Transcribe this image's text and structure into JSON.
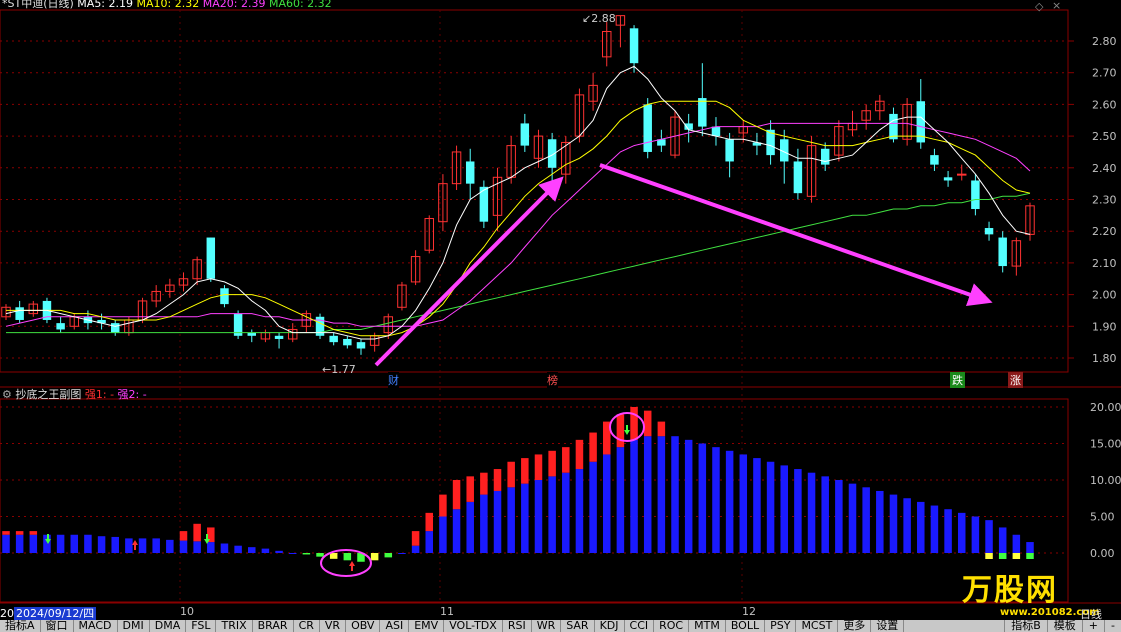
{
  "stock": {
    "name": "*ST中迪(日线)",
    "ma_labels": [
      {
        "text": "MA5: 2.19",
        "color": "#ffffff"
      },
      {
        "text": "MA10: 2.32",
        "color": "#ffff00"
      },
      {
        "text": "MA20: 2.39",
        "color": "#ff40ff"
      },
      {
        "text": "MA60: 2.32",
        "color": "#40e040"
      }
    ]
  },
  "indicator": {
    "name": "抄底之王副图",
    "strong1": "强1: -",
    "strong2": "强2: -"
  },
  "annotations": {
    "high_label": "2.88",
    "low_label": "1.77"
  },
  "event_tags": [
    {
      "text": "财",
      "color": "#4080ff",
      "bg": "#000"
    },
    {
      "text": "榜",
      "color": "#ff5050",
      "bg": "#000"
    },
    {
      "text": "跌",
      "color": "#ffffff",
      "bg": "#1a8a1a"
    },
    {
      "text": "涨",
      "color": "#ffffff",
      "bg": "#8a1a1a"
    }
  ],
  "price_ticks": [
    "2.80",
    "2.70",
    "2.60",
    "2.50",
    "2.40",
    "2.30",
    "2.20",
    "2.10",
    "2.00",
    "1.90",
    "1.80"
  ],
  "ind_ticks": [
    "20.00",
    "15.00",
    "10.00",
    "5.00",
    "0.00"
  ],
  "x_labels": [
    "10",
    "11",
    "12"
  ],
  "date_badge": {
    "prefix": "20",
    "date": "2024/09/12/四"
  },
  "period_label": "日线",
  "watermark": {
    "logo": "万股网",
    "url": "www.201082.com"
  },
  "tabs": [
    "指标A",
    "窗口",
    "MACD",
    "DMI",
    "DMA",
    "FSL",
    "TRIX",
    "BRAR",
    "CR",
    "VR",
    "OBV",
    "ASI",
    "EMV",
    "VOL-TDX",
    "RSI",
    "WR",
    "SAR",
    "KDJ",
    "CCI",
    "ROC",
    "MTM",
    "BOLL",
    "PSY",
    "MCST",
    "更多",
    "设置"
  ],
  "right_tabs": [
    "指标B",
    "模板",
    "+",
    "-"
  ],
  "chart_data": {
    "type": "candlestick",
    "price_range": [
      1.75,
      2.92
    ],
    "ind_range": [
      -2,
      21
    ],
    "candles": [
      [
        1.93,
        1.96,
        1.92,
        1.97
      ],
      [
        1.96,
        1.92,
        1.91,
        1.98
      ],
      [
        1.94,
        1.97,
        1.93,
        1.98
      ],
      [
        1.98,
        1.92,
        1.91,
        1.99
      ],
      [
        1.91,
        1.89,
        1.88,
        1.93
      ],
      [
        1.9,
        1.93,
        1.89,
        1.94
      ],
      [
        1.93,
        1.91,
        1.89,
        1.95
      ],
      [
        1.92,
        1.91,
        1.89,
        1.94
      ],
      [
        1.91,
        1.88,
        1.87,
        1.92
      ],
      [
        1.88,
        1.92,
        1.87,
        1.93
      ],
      [
        1.92,
        1.98,
        1.91,
        1.99
      ],
      [
        1.98,
        2.01,
        1.96,
        2.03
      ],
      [
        2.01,
        2.03,
        1.99,
        2.05
      ],
      [
        2.03,
        2.05,
        2.01,
        2.07
      ],
      [
        2.05,
        2.11,
        2.03,
        2.12
      ],
      [
        2.18,
        2.05,
        2.04,
        2.18
      ],
      [
        2.02,
        1.97,
        1.96,
        2.03
      ],
      [
        1.94,
        1.87,
        1.86,
        1.95
      ],
      [
        1.88,
        1.87,
        1.85,
        1.89
      ],
      [
        1.86,
        1.88,
        1.85,
        1.89
      ],
      [
        1.87,
        1.86,
        1.83,
        1.88
      ],
      [
        1.86,
        1.89,
        1.85,
        1.91
      ],
      [
        1.9,
        1.94,
        1.88,
        1.95
      ],
      [
        1.93,
        1.87,
        1.86,
        1.94
      ],
      [
        1.87,
        1.85,
        1.84,
        1.88
      ],
      [
        1.86,
        1.84,
        1.83,
        1.87
      ],
      [
        1.85,
        1.83,
        1.81,
        1.86
      ],
      [
        1.84,
        1.87,
        1.82,
        1.88
      ],
      [
        1.88,
        1.93,
        1.86,
        1.94
      ],
      [
        1.96,
        2.03,
        1.95,
        2.04
      ],
      [
        2.04,
        2.12,
        2.03,
        2.14
      ],
      [
        2.14,
        2.24,
        2.13,
        2.25
      ],
      [
        2.23,
        2.35,
        2.2,
        2.38
      ],
      [
        2.35,
        2.45,
        2.33,
        2.47
      ],
      [
        2.42,
        2.35,
        2.3,
        2.46
      ],
      [
        2.34,
        2.23,
        2.21,
        2.36
      ],
      [
        2.25,
        2.37,
        2.2,
        2.4
      ],
      [
        2.37,
        2.47,
        2.35,
        2.5
      ],
      [
        2.54,
        2.47,
        2.45,
        2.57
      ],
      [
        2.43,
        2.5,
        2.4,
        2.52
      ],
      [
        2.49,
        2.4,
        2.34,
        2.51
      ],
      [
        2.38,
        2.48,
        2.35,
        2.5
      ],
      [
        2.5,
        2.63,
        2.48,
        2.65
      ],
      [
        2.61,
        2.66,
        2.58,
        2.7
      ],
      [
        2.75,
        2.83,
        2.72,
        2.86
      ],
      [
        2.85,
        2.88,
        2.78,
        2.88
      ],
      [
        2.84,
        2.73,
        2.7,
        2.85
      ],
      [
        2.6,
        2.45,
        2.43,
        2.62
      ],
      [
        2.49,
        2.47,
        2.45,
        2.52
      ],
      [
        2.44,
        2.56,
        2.43,
        2.58
      ],
      [
        2.54,
        2.52,
        2.48,
        2.57
      ],
      [
        2.62,
        2.53,
        2.5,
        2.73
      ],
      [
        2.53,
        2.5,
        2.47,
        2.56
      ],
      [
        2.49,
        2.42,
        2.37,
        2.51
      ],
      [
        2.51,
        2.53,
        2.48,
        2.55
      ],
      [
        2.48,
        2.47,
        2.44,
        2.51
      ],
      [
        2.52,
        2.44,
        2.41,
        2.55
      ],
      [
        2.49,
        2.42,
        2.35,
        2.52
      ],
      [
        2.42,
        2.32,
        2.3,
        2.46
      ],
      [
        2.31,
        2.47,
        2.29,
        2.5
      ],
      [
        2.46,
        2.41,
        2.39,
        2.48
      ],
      [
        2.44,
        2.53,
        2.42,
        2.55
      ],
      [
        2.52,
        2.54,
        2.5,
        2.58
      ],
      [
        2.55,
        2.58,
        2.52,
        2.6
      ],
      [
        2.58,
        2.61,
        2.55,
        2.63
      ],
      [
        2.57,
        2.49,
        2.48,
        2.59
      ],
      [
        2.49,
        2.6,
        2.47,
        2.62
      ],
      [
        2.61,
        2.48,
        2.46,
        2.68
      ],
      [
        2.44,
        2.41,
        2.39,
        2.46
      ],
      [
        2.37,
        2.36,
        2.34,
        2.39
      ],
      [
        2.38,
        2.38,
        2.36,
        2.41
      ],
      [
        2.36,
        2.27,
        2.25,
        2.38
      ],
      [
        2.21,
        2.19,
        2.17,
        2.23
      ],
      [
        2.18,
        2.09,
        2.07,
        2.2
      ],
      [
        2.09,
        2.17,
        2.06,
        2.18
      ],
      [
        2.19,
        2.28,
        2.17,
        2.29
      ]
    ],
    "ma5": [
      1.94,
      1.95,
      1.95,
      1.95,
      1.94,
      1.93,
      1.92,
      1.91,
      1.9,
      1.91,
      1.92,
      1.94,
      1.97,
      2.0,
      2.04,
      2.05,
      2.04,
      2.02,
      1.98,
      1.95,
      1.9,
      1.88,
      1.88,
      1.88,
      1.88,
      1.87,
      1.86,
      1.86,
      1.87,
      1.9,
      1.95,
      2.02,
      2.1,
      2.22,
      2.3,
      2.33,
      2.35,
      2.37,
      2.4,
      2.42,
      2.44,
      2.47,
      2.5,
      2.55,
      2.65,
      2.7,
      2.72,
      2.68,
      2.62,
      2.58,
      2.52,
      2.51,
      2.5,
      2.49,
      2.49,
      2.48,
      2.47,
      2.45,
      2.43,
      2.43,
      2.42,
      2.43,
      2.44,
      2.48,
      2.52,
      2.55,
      2.56,
      2.56,
      2.52,
      2.48,
      2.43,
      2.38,
      2.32,
      2.25,
      2.2,
      2.19
    ],
    "ma10": [
      1.95,
      1.95,
      1.95,
      1.95,
      1.95,
      1.94,
      1.94,
      1.93,
      1.92,
      1.92,
      1.92,
      1.92,
      1.93,
      1.95,
      1.97,
      1.99,
      2.0,
      2.0,
      2.0,
      1.99,
      1.97,
      1.95,
      1.93,
      1.91,
      1.89,
      1.88,
      1.87,
      1.87,
      1.87,
      1.88,
      1.9,
      1.93,
      1.97,
      2.03,
      2.1,
      2.15,
      2.21,
      2.26,
      2.31,
      2.35,
      2.38,
      2.41,
      2.43,
      2.46,
      2.5,
      2.55,
      2.58,
      2.6,
      2.61,
      2.61,
      2.61,
      2.61,
      2.61,
      2.59,
      2.55,
      2.53,
      2.51,
      2.5,
      2.49,
      2.48,
      2.47,
      2.47,
      2.47,
      2.48,
      2.49,
      2.5,
      2.5,
      2.5,
      2.49,
      2.48,
      2.46,
      2.44,
      2.4,
      2.36,
      2.33,
      2.32
    ],
    "ma20": [
      1.9,
      1.91,
      1.92,
      1.93,
      1.93,
      1.93,
      1.93,
      1.93,
      1.93,
      1.93,
      1.93,
      1.93,
      1.93,
      1.93,
      1.93,
      1.94,
      1.94,
      1.94,
      1.94,
      1.93,
      1.93,
      1.92,
      1.92,
      1.92,
      1.91,
      1.91,
      1.9,
      1.9,
      1.9,
      1.9,
      1.9,
      1.91,
      1.92,
      1.95,
      1.98,
      2.02,
      2.06,
      2.1,
      2.15,
      2.2,
      2.25,
      2.29,
      2.33,
      2.37,
      2.41,
      2.45,
      2.47,
      2.48,
      2.49,
      2.5,
      2.51,
      2.52,
      2.53,
      2.53,
      2.53,
      2.53,
      2.54,
      2.54,
      2.54,
      2.54,
      2.54,
      2.54,
      2.54,
      2.54,
      2.54,
      2.54,
      2.54,
      2.53,
      2.52,
      2.51,
      2.5,
      2.49,
      2.47,
      2.45,
      2.43,
      2.39
    ],
    "ma60": [
      1.88,
      1.88,
      1.88,
      1.88,
      1.88,
      1.88,
      1.88,
      1.88,
      1.88,
      1.88,
      1.88,
      1.88,
      1.88,
      1.88,
      1.88,
      1.88,
      1.88,
      1.88,
      1.88,
      1.88,
      1.88,
      1.88,
      1.88,
      1.88,
      1.89,
      1.89,
      1.89,
      1.9,
      1.91,
      1.92,
      1.93,
      1.94,
      1.95,
      1.96,
      1.97,
      1.98,
      1.99,
      2.0,
      2.01,
      2.02,
      2.03,
      2.04,
      2.05,
      2.06,
      2.07,
      2.08,
      2.09,
      2.1,
      2.11,
      2.12,
      2.13,
      2.14,
      2.15,
      2.16,
      2.17,
      2.18,
      2.19,
      2.2,
      2.21,
      2.22,
      2.23,
      2.24,
      2.25,
      2.25,
      2.26,
      2.27,
      2.27,
      2.28,
      2.28,
      2.29,
      2.29,
      2.3,
      2.3,
      2.31,
      2.31,
      2.32
    ],
    "ind_blue": [
      2.5,
      2.5,
      2.5,
      2.5,
      2.5,
      2.5,
      2.5,
      2.3,
      2.2,
      2.0,
      2.0,
      2.0,
      1.8,
      1.7,
      1.6,
      1.5,
      1.3,
      1.0,
      0.8,
      0.6,
      0.3,
      0.0,
      -0.2,
      -0.5,
      -0.8,
      -1.0,
      -1.2,
      -1.0,
      -0.6,
      0.0,
      1.0,
      3.0,
      5.0,
      6.0,
      7.0,
      8.0,
      8.5,
      9.0,
      9.5,
      10.0,
      10.5,
      11.0,
      11.5,
      12.5,
      13.5,
      14.5,
      15.5,
      16.0,
      16.0,
      16.0,
      15.5,
      15.0,
      14.5,
      14.0,
      13.5,
      13.0,
      12.5,
      12.0,
      11.5,
      11.0,
      10.5,
      10.0,
      9.5,
      9.0,
      8.5,
      8.0,
      7.5,
      7.0,
      6.5,
      6.0,
      5.5,
      5.0,
      4.5,
      3.5,
      2.5,
      1.5
    ],
    "ind_red": [
      0,
      0,
      0,
      0,
      0,
      0,
      0,
      0,
      0,
      0,
      0,
      0,
      0,
      0,
      0,
      0,
      0,
      0,
      0,
      0,
      0,
      0,
      0,
      0,
      0,
      0,
      0,
      0,
      0,
      0,
      3.0,
      5.5,
      8.0,
      10.0,
      10.5,
      11.0,
      11.5,
      12.5,
      13.0,
      13.5,
      14.0,
      14.5,
      15.5,
      16.5,
      18.0,
      19.0,
      20.0,
      19.5,
      18.0,
      0,
      0,
      0,
      0,
      0,
      0,
      0,
      0,
      0,
      0,
      0,
      0,
      0,
      0,
      0,
      0,
      0,
      0,
      0,
      0,
      0,
      0,
      0,
      0,
      0,
      0,
      0
    ]
  }
}
